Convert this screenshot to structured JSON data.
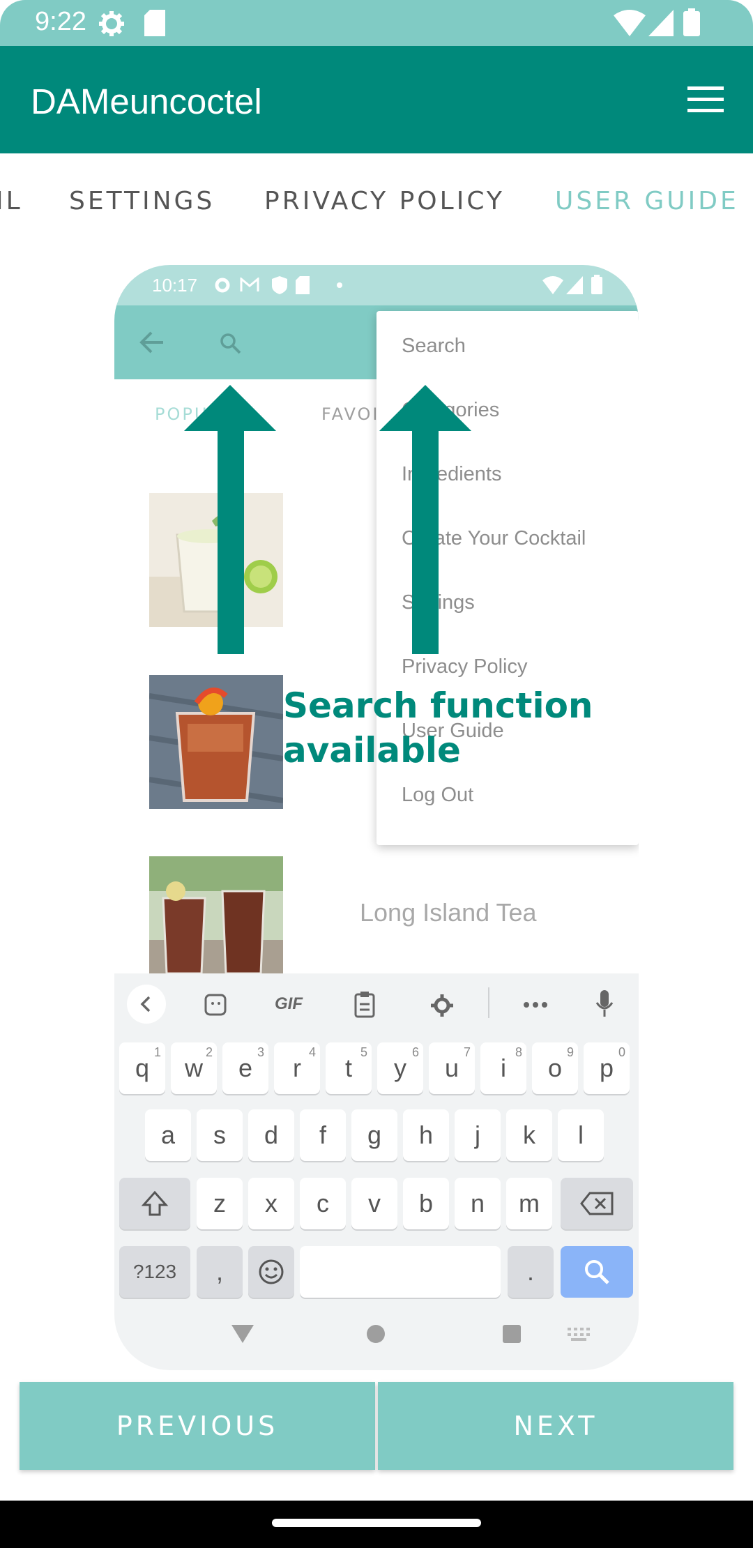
{
  "status_bar": {
    "time": "9:22",
    "icons": [
      "gear-icon",
      "sd-card-icon",
      "wifi-icon",
      "signal-icon",
      "battery-icon"
    ]
  },
  "app_bar": {
    "title": "DAMeuncoctel",
    "menu_icon": "hamburger-menu-icon"
  },
  "tabs": [
    {
      "label": "IL",
      "active": false
    },
    {
      "label": "SETTINGS",
      "active": false
    },
    {
      "label": "PRIVACY POLICY",
      "active": false
    },
    {
      "label": "USER GUIDE",
      "active": true
    }
  ],
  "guide_screenshot": {
    "status_time": "10:17",
    "inner_tabs": [
      "POPU",
      "FAVOI"
    ],
    "list_item_label": "Long Island Tea",
    "menu_items": [
      "Search",
      "Categories",
      "Ingredients",
      "Create Your Cocktail",
      "Settings",
      "Privacy Policy",
      "User Guide",
      "Log Out"
    ],
    "caption_line1": "Search function",
    "caption_line2": "available",
    "keyboard": {
      "row1": [
        [
          "q",
          "1"
        ],
        [
          "w",
          "2"
        ],
        [
          "e",
          "3"
        ],
        [
          "r",
          "4"
        ],
        [
          "t",
          "5"
        ],
        [
          "y",
          "6"
        ],
        [
          "u",
          "7"
        ],
        [
          "i",
          "8"
        ],
        [
          "o",
          "9"
        ],
        [
          "p",
          "0"
        ]
      ],
      "row2": [
        "a",
        "s",
        "d",
        "f",
        "g",
        "h",
        "j",
        "k",
        "l"
      ],
      "row3": [
        "z",
        "x",
        "c",
        "v",
        "b",
        "n",
        "m"
      ],
      "symbols_label": "?123",
      "comma": ",",
      "period": ".",
      "gif_label": "GIF"
    }
  },
  "buttons": {
    "previous": "PREVIOUS",
    "next": "NEXT"
  },
  "colors": {
    "primary": "#00897b",
    "primary_light": "#80cbc4",
    "keyboard_action": "#8ab4f8"
  }
}
